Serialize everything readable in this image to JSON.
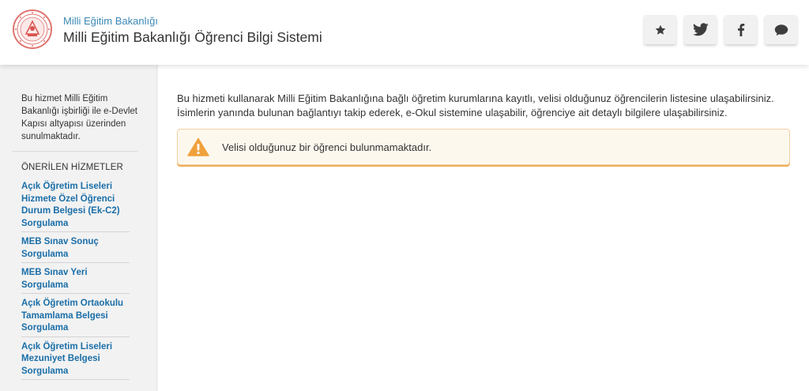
{
  "header": {
    "org_name": "Milli Eğitim Bakanlığı",
    "app_title": "Milli Eğitim Bakanlığı Öğrenci Bilgi Sistemi",
    "logo_icon": "meb-seal-logo"
  },
  "social_buttons": [
    {
      "icon": "star-icon"
    },
    {
      "icon": "twitter-icon"
    },
    {
      "icon": "facebook-icon"
    },
    {
      "icon": "chat-bubble-icon"
    }
  ],
  "sidebar": {
    "info": "Bu hizmet Milli Eğitim Bakanlığı işbirliği ile e-Devlet Kapısı altyapısı üzerinden sunulmaktadır.",
    "heading": "ÖNERİLEN HİZMETLER",
    "items": [
      {
        "label": "Açık Öğretim Liseleri Hizmete Özel Öğrenci Durum Belgesi (Ek-C2) Sorgulama"
      },
      {
        "label": "MEB Sınav Sonuç Sorgulama"
      },
      {
        "label": "MEB Sınav Yeri Sorgulama"
      },
      {
        "label": "Açık Öğretim Ortaokulu Tamamlama Belgesi Sorgulama"
      },
      {
        "label": "Açık Öğretim Liseleri Mezuniyet Belgesi Sorgulama"
      }
    ]
  },
  "main": {
    "description": "Bu hizmeti kullanarak Milli Eğitim Bakanlığına bağlı öğretim kurumlarına kayıtlı, velisi olduğunuz öğrencilerin listesine ulaşabilirsiniz. İsimlerin yanında bulunan bağlantıyı takip ederek, e-Okul sistemine ulaşabilir, öğrenciye ait detaylı bilgilere ulaşabilirsiniz.",
    "alert_text": "Velisi olduğunuz bir öğrenci bulunmamaktadır.",
    "alert_icon": "warning-icon"
  },
  "colors": {
    "link": "#1a6ea8",
    "org_name": "#3b88b5",
    "alert_accent": "#f0ad5a",
    "logo_red": "#d9534f"
  }
}
